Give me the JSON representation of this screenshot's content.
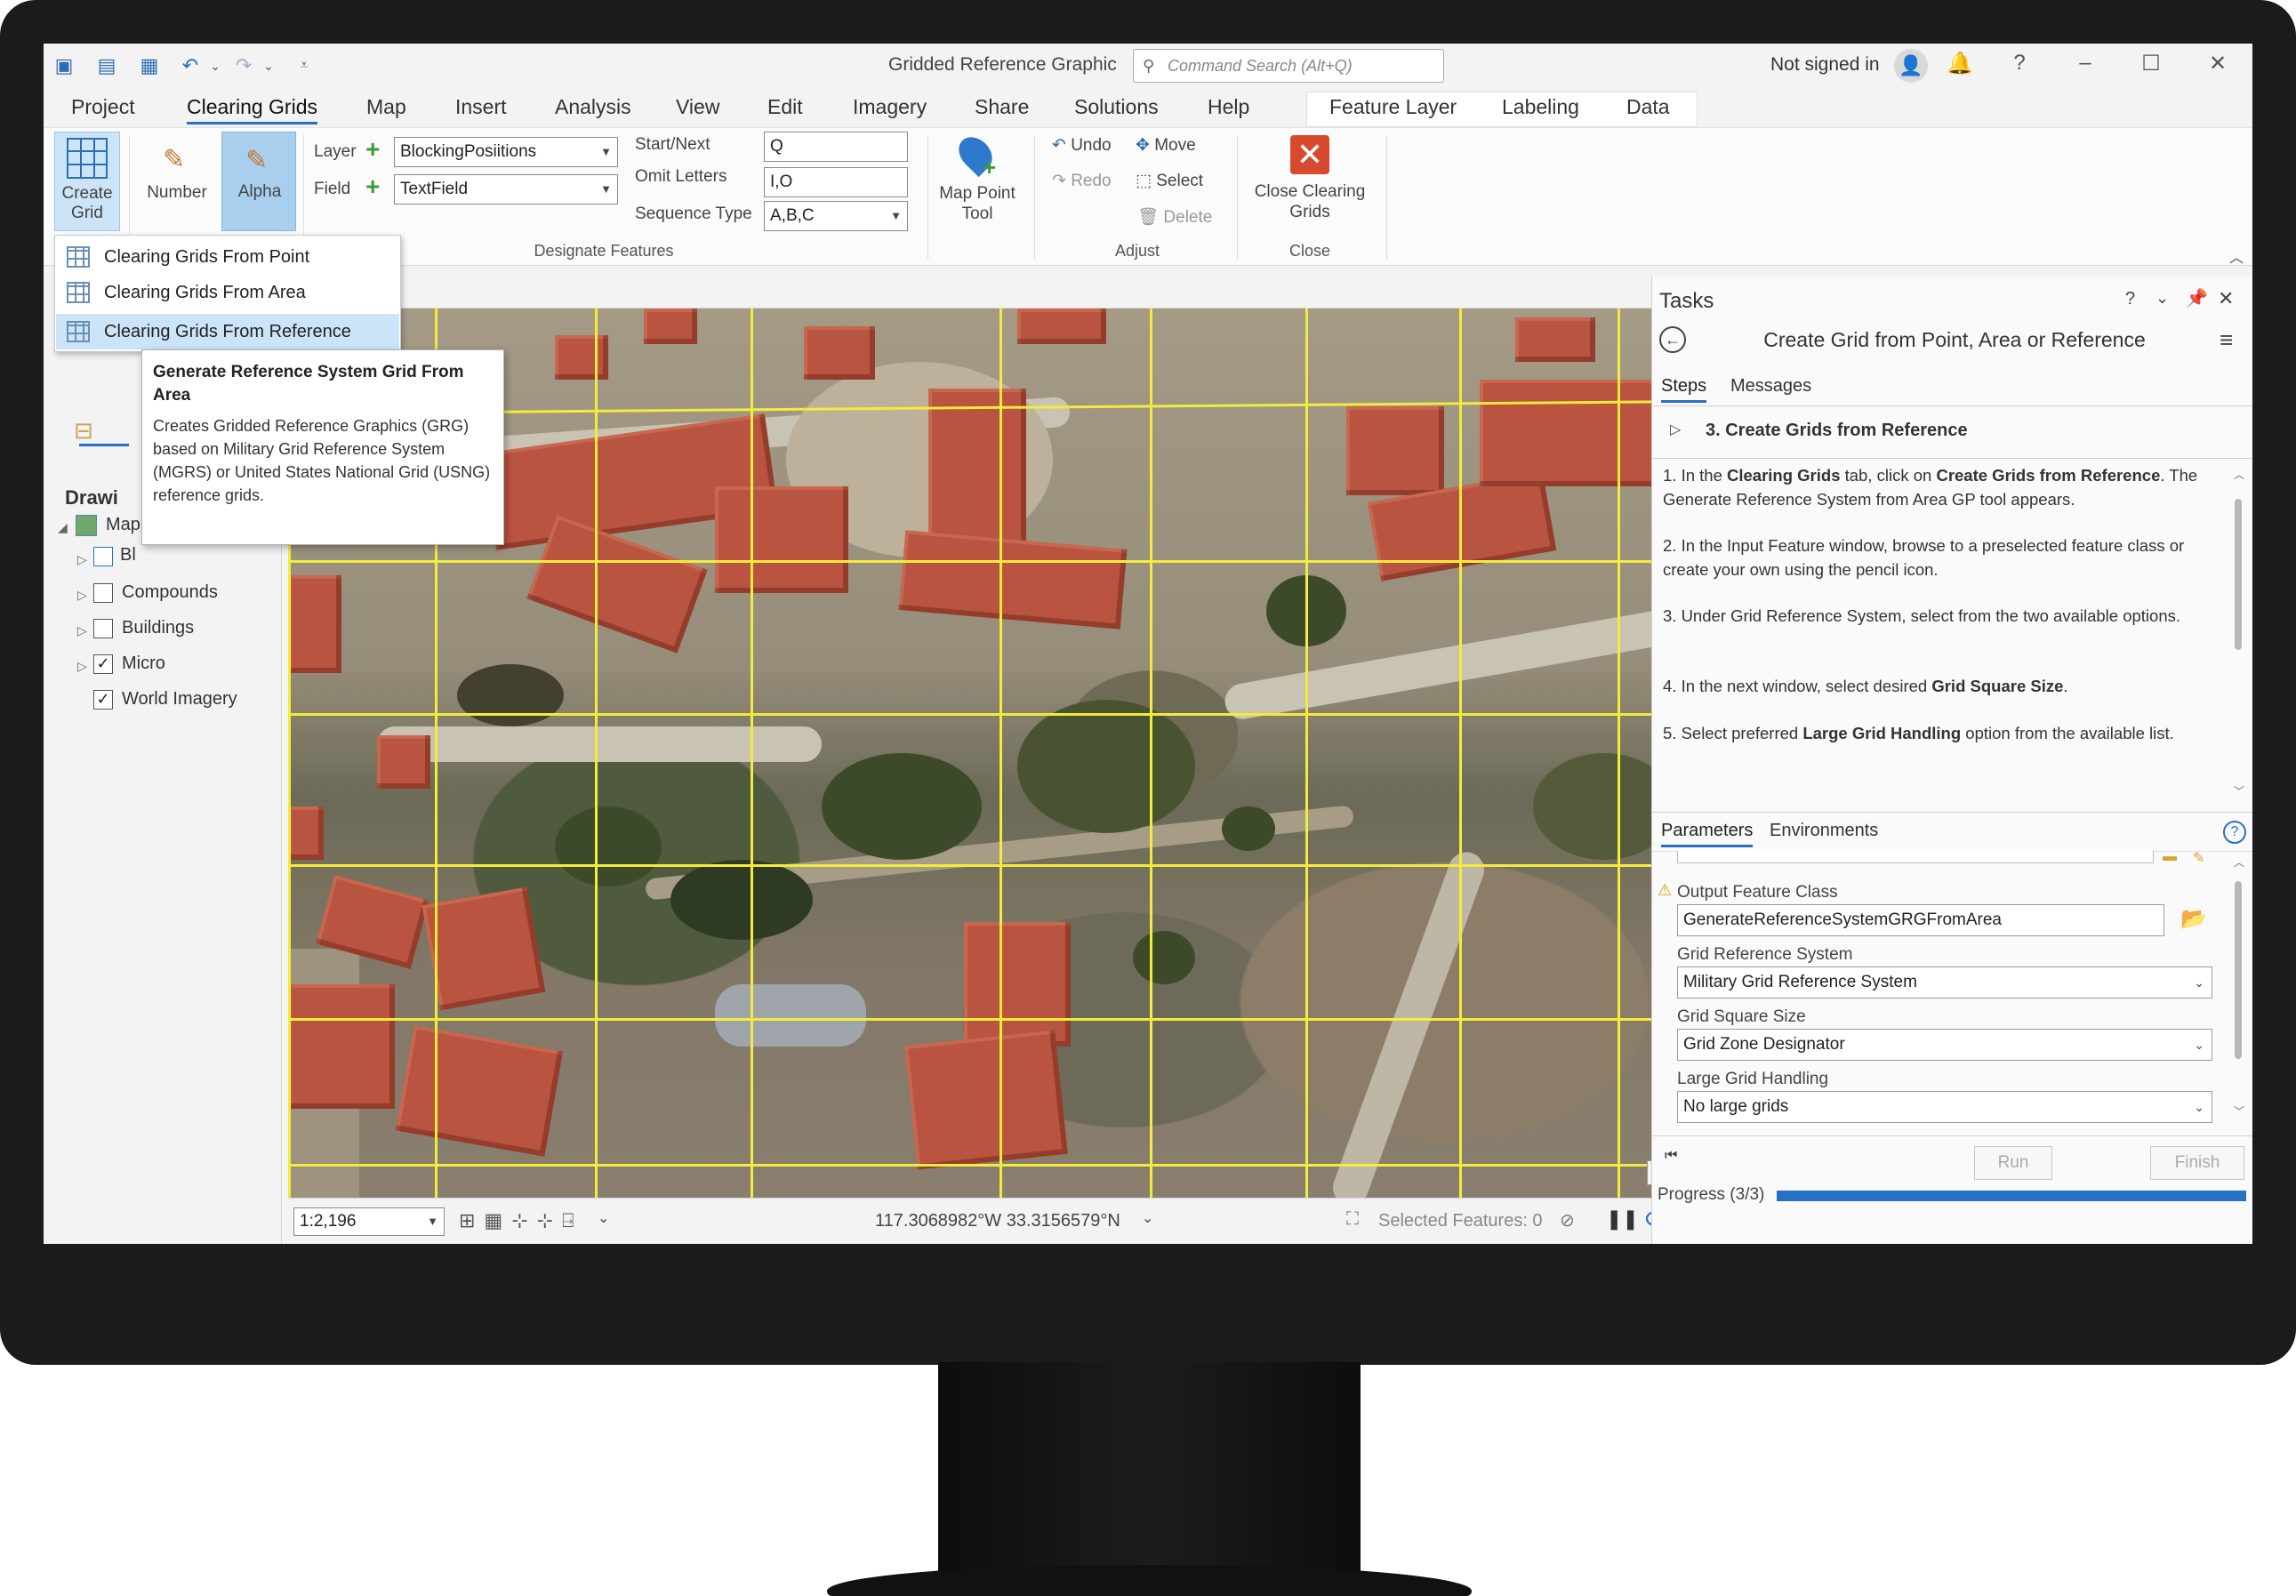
{
  "window": {
    "title": "Gridded Reference Graphic",
    "search_placeholder": "Command Search (Alt+Q)",
    "signin": "Not signed in"
  },
  "tabs": [
    "Project",
    "Clearing Grids",
    "Map",
    "Insert",
    "Analysis",
    "View",
    "Edit",
    "Imagery",
    "Share",
    "Solutions",
    "Help"
  ],
  "context_tabs": [
    "Feature Layer",
    "Labeling",
    "Data"
  ],
  "active_tab": "Clearing Grids",
  "ribbon": {
    "create_grid": "Create Grid",
    "number": "Number",
    "alpha": "Alpha",
    "layer_label": "Layer",
    "layer_value": "BlockingPosiitions",
    "field_label": "Field",
    "field_value": "TextField",
    "start_next_label": "Start/Next",
    "start_next_value": "Q",
    "omit_letters_label": "Omit Letters",
    "omit_letters_value": "I,O",
    "sequence_type_label": "Sequence Type",
    "sequence_type_value": "A,B,C",
    "designate_group": "Designate Features",
    "map_point_tool": "Map Point Tool",
    "undo": "Undo",
    "redo": "Redo",
    "move": "Move",
    "select": "Select",
    "delete": "Delete",
    "adjust_group": "Adjust",
    "close_clearing": "Close Clearing Grids",
    "close_group": "Close"
  },
  "menu": {
    "items": [
      "Clearing Grids From Point",
      "Clearing Grids From Area",
      "Clearing Grids From Reference"
    ]
  },
  "tooltip": {
    "title": "Generate Reference System Grid From Area",
    "body": "Creates Gridded Reference Graphics (GRG) based on Military Grid Reference System (MGRS) or United States National Grid (USNG) reference grids."
  },
  "toc": {
    "drawing_label": "Drawi",
    "map_label": "Map",
    "bl_label": "Bl",
    "layers": [
      {
        "name": "Compounds",
        "checked": false
      },
      {
        "name": "Buildings",
        "checked": false
      },
      {
        "name": "Micro",
        "checked": true
      },
      {
        "name": "World Imagery",
        "checked": true
      }
    ]
  },
  "mapstatus": {
    "scale": "1:2,196",
    "coords": "117.3068982°W 33.3156579°N",
    "selected": "Selected Features: 0"
  },
  "tasks": {
    "pane_title": "Tasks",
    "task_title": "Create Grid from Point, Area or Reference",
    "tab_steps": "Steps",
    "tab_messages": "Messages",
    "step_heading": "3.  Create Grids from Reference",
    "step1_a": "1. In the ",
    "step1_b": "Clearing Grids",
    "step1_c": " tab, click on ",
    "step1_d": "Create Grids from Reference",
    "step1_e": ". The Generate Reference System from Area GP tool appears.",
    "step2": "2. In the Input Feature window, browse to a preselected feature class or create your own using the pencil icon.",
    "step3": "3. Under Grid Reference System, select from the two available options.",
    "step4_a": "4. In the next window, select desired ",
    "step4_b": "Grid Square Size",
    "step4_c": ".",
    "step5_a": "5. Select preferred ",
    "step5_b": "Large Grid Handling",
    "step5_c": " option from the available list.",
    "tab_parameters": "Parameters",
    "tab_environments": "Environments",
    "output_label": "Output Feature Class",
    "output_value": "GenerateReferenceSystemGRGFromArea",
    "grs_label": "Grid Reference System",
    "grs_value": "Military Grid Reference System",
    "gss_label": "Grid Square Size",
    "gss_value": "Grid Zone Designator",
    "lgh_label": "Large Grid Handling",
    "lgh_value": "No large grids",
    "run": "Run",
    "finish": "Finish",
    "progress_label": "Progress (3/3)",
    "progress": 1.0
  },
  "colors": {
    "accent": "#2771c5",
    "grid": "#f2ec3a",
    "roof": "#b8543f"
  }
}
